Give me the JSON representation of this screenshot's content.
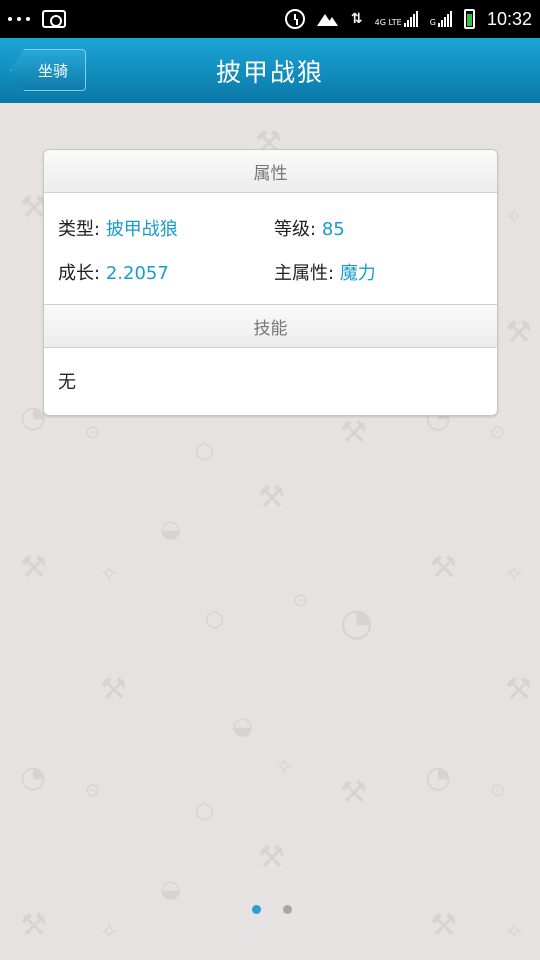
{
  "status_bar": {
    "network_label_1": "4G LTE",
    "network_label_2": "G",
    "time": "10:32",
    "icons": [
      "more-dots-icon",
      "camera-icon",
      "alarm-icon",
      "weather-icon",
      "data-arrows-icon",
      "signal-icon",
      "battery-icon"
    ]
  },
  "header": {
    "back_label": "坐骑",
    "title": "披甲战狼"
  },
  "card": {
    "attributes_title": "属性",
    "type_label": "类型:",
    "type_value": "披甲战狼",
    "level_label": "等级:",
    "level_value": "85",
    "growth_label": "成长:",
    "growth_value": "2.2057",
    "main_attr_label": "主属性:",
    "main_attr_value": "魔力",
    "skills_title": "技能",
    "skills_value": "无"
  },
  "pager": {
    "count": 2,
    "active_index": 0
  },
  "colors": {
    "accent": "#1a9bd0",
    "title_bar": "#0f8fc2",
    "background": "#e5e2e1",
    "battery": "#2fc23a"
  }
}
